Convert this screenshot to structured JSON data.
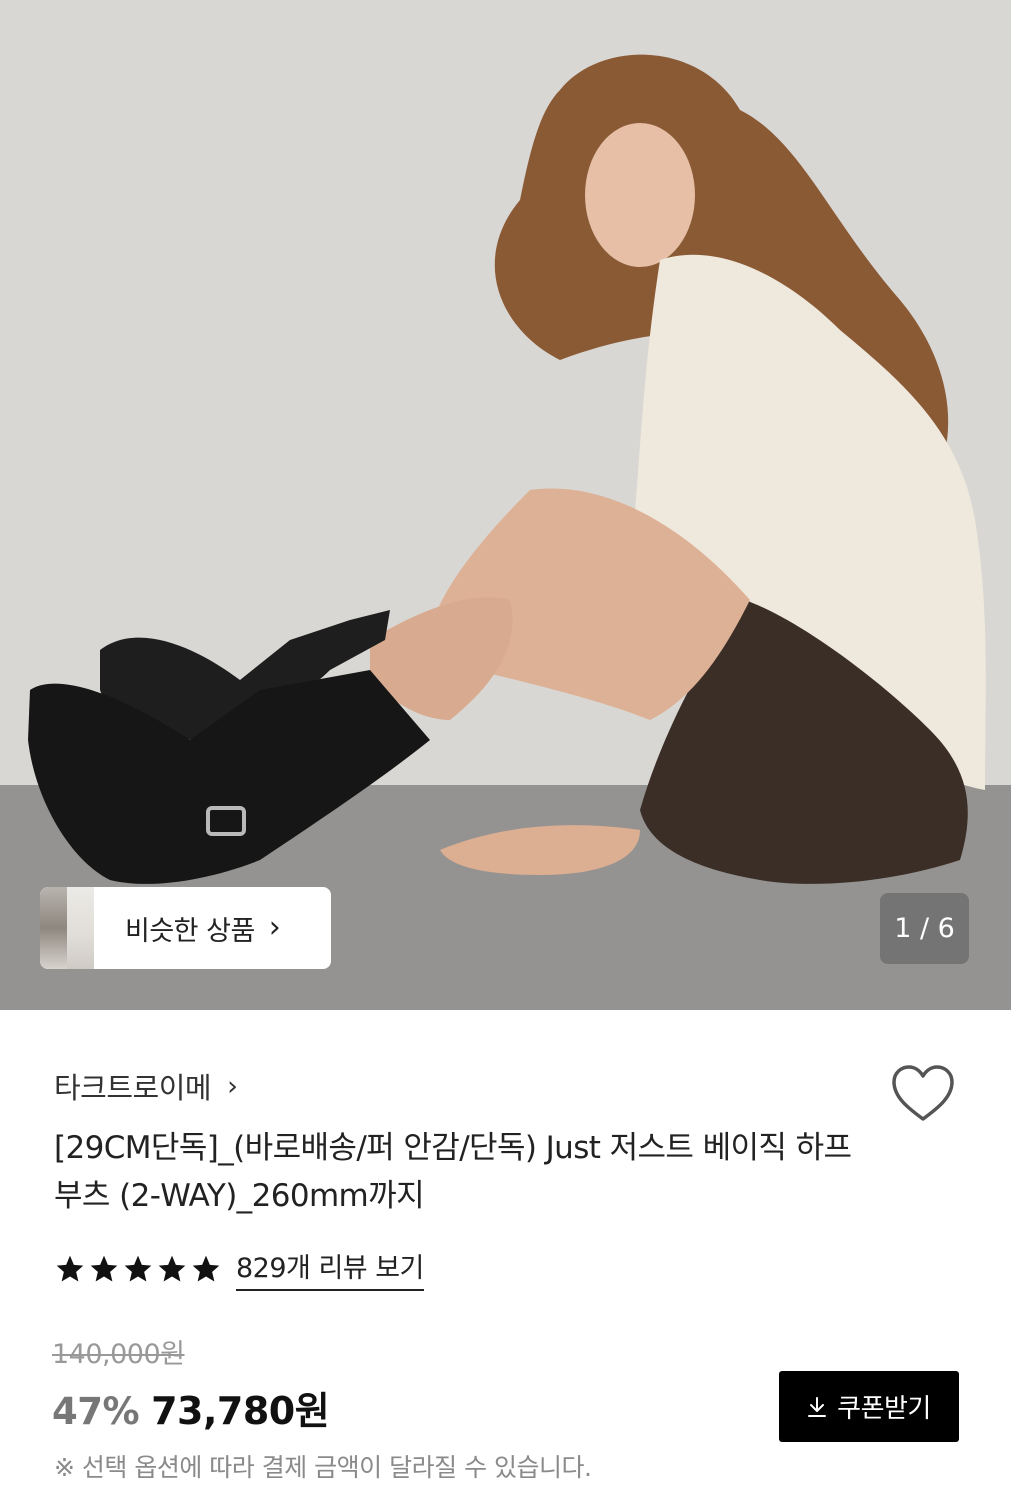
{
  "hero": {
    "similar_button_label": "비슷한 상품",
    "similar_chevron": "›",
    "image_counter": "1 / 6"
  },
  "product": {
    "brand": "타크트로이메",
    "brand_chevron": "›",
    "title": "[29CM단독]_(바로배송/퍼 안감/단독) Just 저스트 베이직 하프 부츠 (2-WAY)_260mm까지",
    "rating_stars": 5,
    "review_link": "829개 리뷰 보기",
    "original_price": "140,000원",
    "discount_rate": "47%",
    "sale_price": "73,780원",
    "coupon_button": "쿠폰받기",
    "notice": "※ 선택 옵션에 따라 결제 금액이 달라질 수 있습니다."
  },
  "icons": {
    "heart": "heart-outline-icon",
    "star": "star-filled-icon",
    "download": "download-icon",
    "chevron": "chevron-right-icon"
  },
  "colors": {
    "primary_text": "#111111",
    "muted_text": "#8a8a8a",
    "discount": "#777777",
    "button_bg": "#000000",
    "counter_bg": "#6e6e6e"
  }
}
